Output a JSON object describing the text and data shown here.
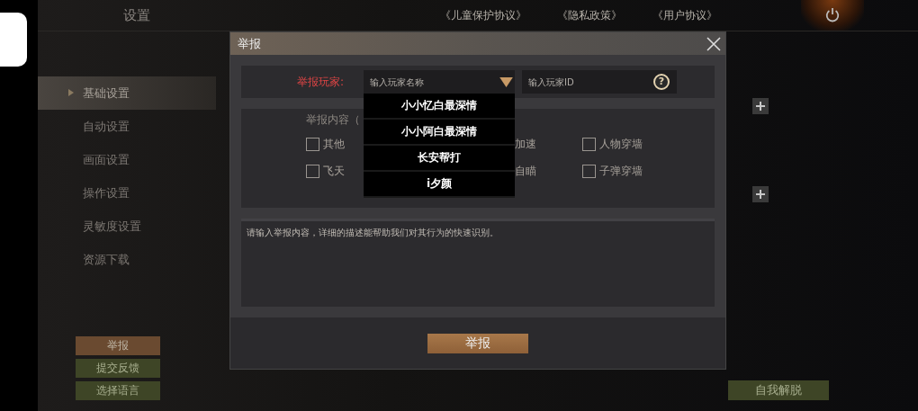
{
  "header": {
    "title": "设置",
    "links": [
      "《儿童保护协议》",
      "《隐私政策》",
      "《用户协议》"
    ]
  },
  "sidebar": {
    "items": [
      {
        "label": "基础设置",
        "selected": true
      },
      {
        "label": "自动设置",
        "selected": false
      },
      {
        "label": "画面设置",
        "selected": false
      },
      {
        "label": "操作设置",
        "selected": false
      },
      {
        "label": "灵敏度设置",
        "selected": false
      },
      {
        "label": "资源下载",
        "selected": false
      }
    ]
  },
  "side_buttons": [
    {
      "label": "举报",
      "kind": "report"
    },
    {
      "label": "提交反馈",
      "kind": "plain"
    },
    {
      "label": "选择语言",
      "kind": "plain"
    }
  ],
  "unstuck_button": "自我解脱",
  "dialog": {
    "title": "举报",
    "player_label": "举报玩家:",
    "name_field": {
      "placeholder": "输入玩家名称"
    },
    "id_field": {
      "placeholder": "输入玩家ID",
      "help": "?"
    },
    "dropdown_options": [
      "小小忆白最深情",
      "小小阿白最深情",
      "长安帮打",
      "ⅰ夕颜"
    ],
    "content_label": "举报内容（",
    "options": [
      {
        "label": "其他",
        "kind": "checkbox",
        "checked": false
      },
      {
        "label": "加速",
        "kind": "text"
      },
      {
        "label": "人物穿墙",
        "kind": "checkbox",
        "checked": false
      },
      {
        "label": "飞天",
        "kind": "checkbox",
        "checked": false
      },
      {
        "label": "自瞄",
        "kind": "text"
      },
      {
        "label": "子弹穿墙",
        "kind": "checkbox",
        "checked": false
      }
    ],
    "description": {
      "placeholder": "请输入举报内容，详细的描述能帮助我们对其行为的快速识别。"
    },
    "submit": "举报"
  }
}
